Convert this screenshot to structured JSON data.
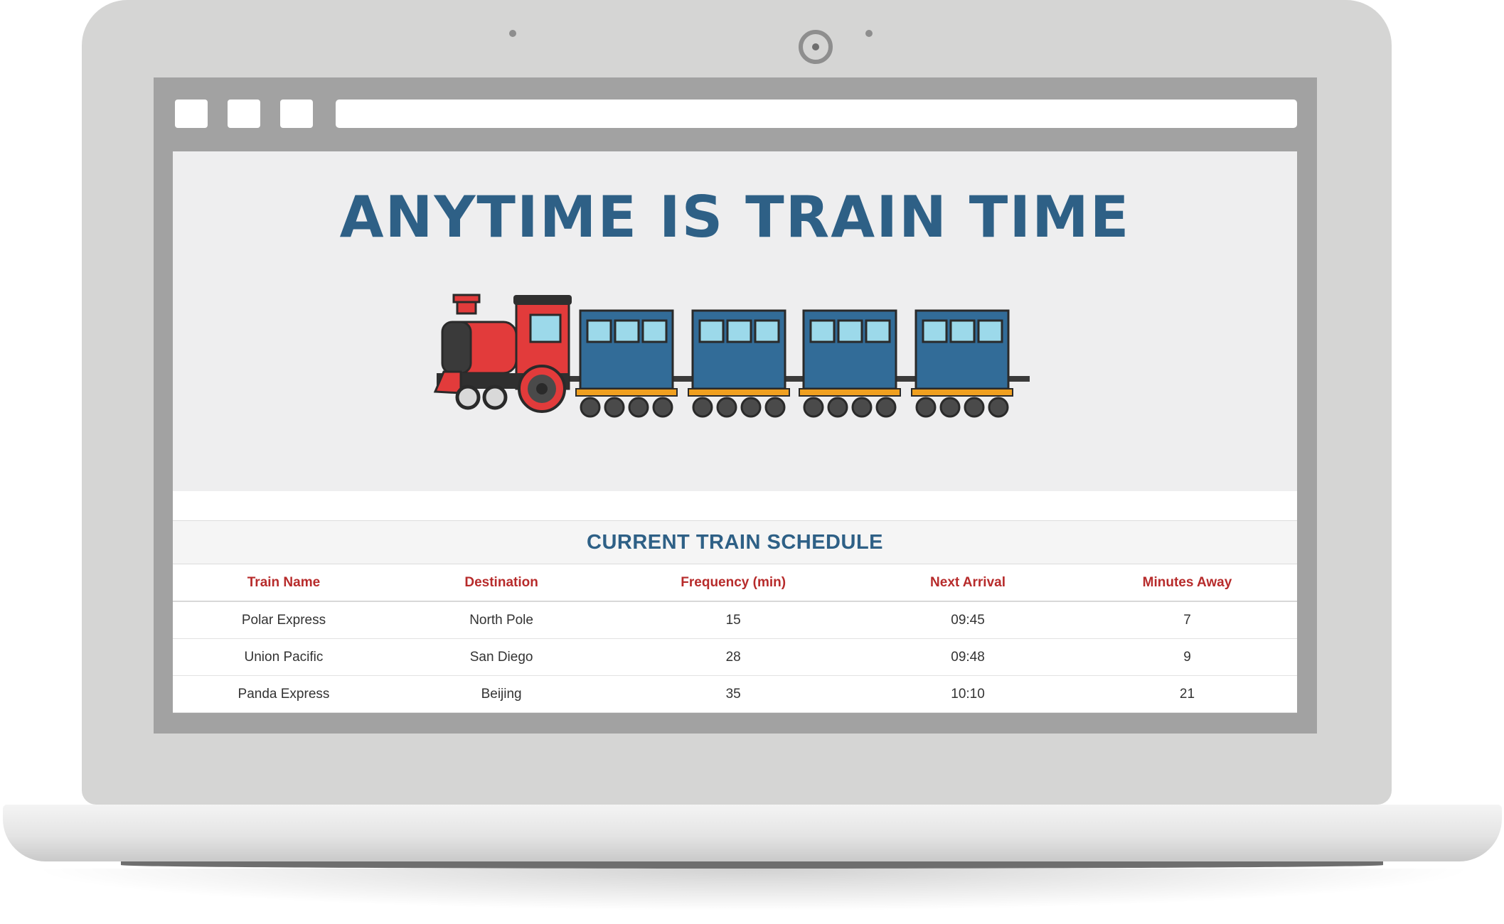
{
  "hero": {
    "title": "Anytime is Train Time"
  },
  "schedule": {
    "title": "Current Train Schedule",
    "columns": [
      "Train Name",
      "Destination",
      "Frequency (min)",
      "Next Arrival",
      "Minutes Away"
    ],
    "rows": [
      [
        "Polar Express",
        "North Pole",
        "15",
        "09:45",
        "7"
      ],
      [
        "Union Pacific",
        "San Diego",
        "28",
        "09:48",
        "9"
      ],
      [
        "Panda Express",
        "Beijing",
        "35",
        "10:10",
        "21"
      ]
    ]
  },
  "colors": {
    "title_blue": "#2e6086",
    "header_red": "#b72b2b",
    "locomotive_red": "#e23b3b",
    "car_blue": "#326c98"
  }
}
